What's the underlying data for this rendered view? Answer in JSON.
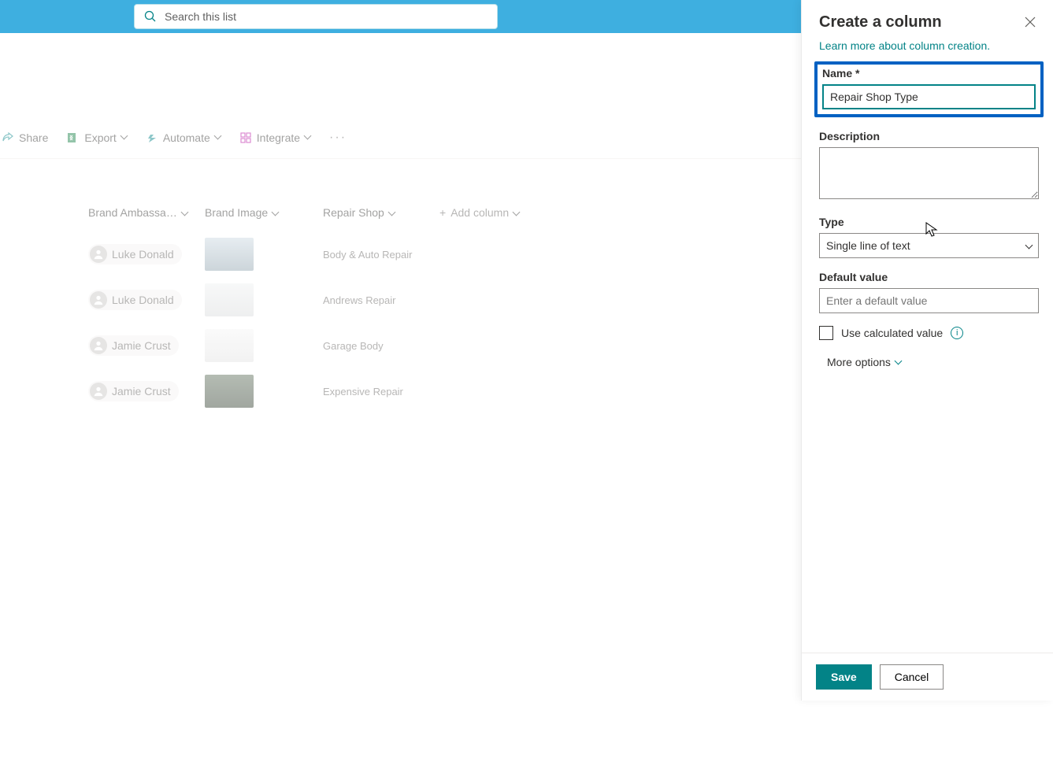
{
  "search": {
    "placeholder": "Search this list"
  },
  "commands": {
    "share": "Share",
    "export": "Export",
    "automate": "Automate",
    "integrate": "Integrate"
  },
  "columns": {
    "brand_ambassador": "Brand Ambassa…",
    "brand_image": "Brand Image",
    "repair_shop": "Repair Shop",
    "add_column": "Add column"
  },
  "rows": [
    {
      "person": "Luke Donald",
      "repair": "Body & Auto Repair"
    },
    {
      "person": "Luke Donald",
      "repair": "Andrews Repair"
    },
    {
      "person": "Jamie Crust",
      "repair": "Garage Body"
    },
    {
      "person": "Jamie Crust",
      "repair": "Expensive Repair"
    }
  ],
  "panel": {
    "title": "Create a column",
    "learn_more": "Learn more about column creation.",
    "name_label": "Name *",
    "name_value": "Repair Shop Type",
    "description_label": "Description",
    "type_label": "Type",
    "type_value": "Single line of text",
    "default_label": "Default value",
    "default_placeholder": "Enter a default value",
    "calc_label": "Use calculated value",
    "more_options": "More options",
    "save": "Save",
    "cancel": "Cancel"
  }
}
